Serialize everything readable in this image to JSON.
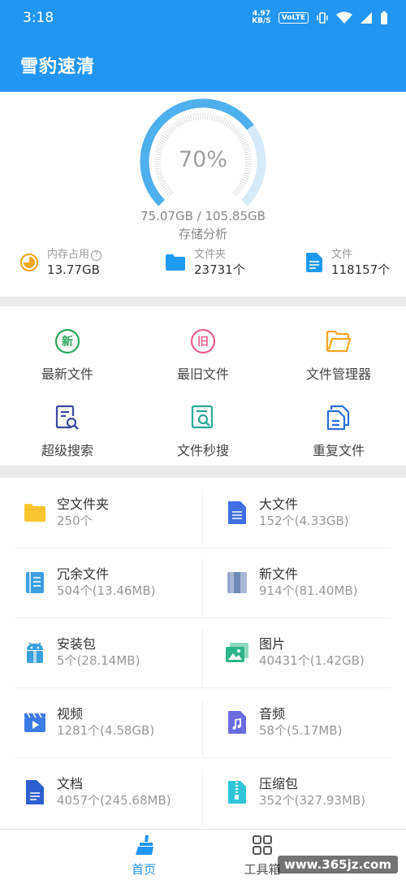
{
  "status_bar": {
    "time": "3:18",
    "net_speed_value": "4.97",
    "net_speed_unit": "KB/S",
    "volte": "VoLTE"
  },
  "app": {
    "title": "雪豹速清"
  },
  "storage": {
    "percent_text": "70%",
    "percent": 70,
    "size_text": "75.07GB / 105.85GB",
    "label": "存储分析"
  },
  "stats": [
    {
      "label": "内存占用",
      "value": "13.77GB",
      "icon": "memory-pie-icon",
      "color": "#F5A623"
    },
    {
      "label": "文件夹",
      "value": "23731个",
      "icon": "folder-icon",
      "color": "#1E9BF0"
    },
    {
      "label": "文件",
      "value": "118157个",
      "icon": "file-icon",
      "color": "#1E9BF0"
    }
  ],
  "tools": [
    {
      "label": "最新文件",
      "icon": "new-badge-icon",
      "glyph": "新",
      "color": "#2EA55A"
    },
    {
      "label": "最旧文件",
      "icon": "old-badge-icon",
      "glyph": "旧",
      "color": "#E8608A"
    },
    {
      "label": "文件管理器",
      "icon": "folder-open-icon",
      "color": "#F5A623"
    },
    {
      "label": "超级搜索",
      "icon": "doc-search-icon",
      "color": "#3A4A9F"
    },
    {
      "label": "文件秒搜",
      "icon": "quick-search-icon",
      "color": "#2AA89A"
    },
    {
      "label": "重复文件",
      "icon": "duplicate-files-icon",
      "color": "#2D6FD8"
    }
  ],
  "categories": [
    {
      "name": "空文件夹",
      "count": "250个",
      "icon": "empty-folder-icon",
      "color": "#F8C630"
    },
    {
      "name": "大文件",
      "count": "152个(4.33GB)",
      "icon": "big-file-icon",
      "color": "#3F6FE0"
    },
    {
      "name": "冗余文件",
      "count": "504个(13.46MB)",
      "icon": "redundant-file-icon",
      "color": "#3CA0E0"
    },
    {
      "name": "新文件",
      "count": "914个(81.40MB)",
      "icon": "new-file-icon",
      "color": "#6E8AB8"
    },
    {
      "name": "安装包",
      "count": "5个(28.14MB)",
      "icon": "android-package-icon",
      "color": "#3AA0DB"
    },
    {
      "name": "图片",
      "count": "40431个(1.42GB)",
      "icon": "image-icon",
      "color": "#2EB58A"
    },
    {
      "name": "视频",
      "count": "1281个(4.58GB)",
      "icon": "video-icon",
      "color": "#3D7BE6"
    },
    {
      "name": "音频",
      "count": "58个(5.17MB)",
      "icon": "audio-icon",
      "color": "#6A6CE0"
    },
    {
      "name": "文档",
      "count": "4057个(245.68MB)",
      "icon": "document-icon",
      "color": "#2D5FD0"
    },
    {
      "name": "压缩包",
      "count": "352个(327.93MB)",
      "icon": "archive-icon",
      "color": "#2EC5D8"
    }
  ],
  "bottom_nav": [
    {
      "label": "首页",
      "icon": "broom-icon",
      "active": true,
      "color": "#2196F3"
    },
    {
      "label": "工具箱",
      "icon": "grid-icon",
      "active": false,
      "color": "#555555"
    }
  ],
  "watermark": "www.365jz.com"
}
